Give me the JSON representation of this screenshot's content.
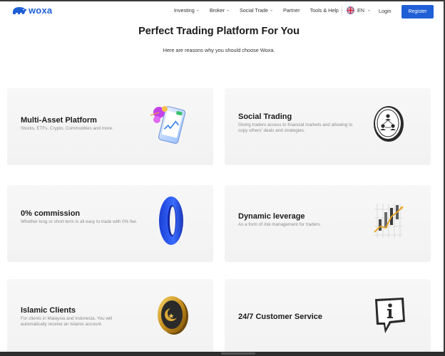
{
  "brand": {
    "name": "woxa",
    "color": "#1f5fd6"
  },
  "nav": {
    "items": [
      {
        "label": "Investing",
        "dropdown": true
      },
      {
        "label": "Broker",
        "dropdown": true
      },
      {
        "label": "Social Trade",
        "dropdown": true
      },
      {
        "label": "Partner",
        "dropdown": false
      },
      {
        "label": "Tools & Help",
        "dropdown": true
      }
    ],
    "language": "EN",
    "login_label": "Login",
    "register_label": "Register"
  },
  "hero": {
    "title": "Perfect Trading Platform For You",
    "subtitle": "Here are reasons why you should choose Woxa."
  },
  "features": [
    {
      "title": "Multi-Asset Platform",
      "desc": "Stocks, ETFs, Crypto, Commodities and more.",
      "icon": "phone-chart-icon"
    },
    {
      "title": "Social Trading",
      "desc": "Giving traders access to financial markets and allowing to copy others' deals and strategies.",
      "icon": "network-users-icon"
    },
    {
      "title": "0% commission",
      "desc": "Whether long or short term is all easy to trade with 0% fee.",
      "icon": "zero-icon"
    },
    {
      "title": "Dynamic leverage",
      "desc": "As a form of risk management for traders.",
      "icon": "leverage-chart-icon"
    },
    {
      "title": "Islamic Clients",
      "desc": "For clients in Malaysia and Indonesia. You will automatically receive an Islamic account.",
      "icon": "crescent-star-coin-icon"
    },
    {
      "title": "24/7 Customer Service",
      "desc": "",
      "icon": "info-chat-icon"
    }
  ]
}
